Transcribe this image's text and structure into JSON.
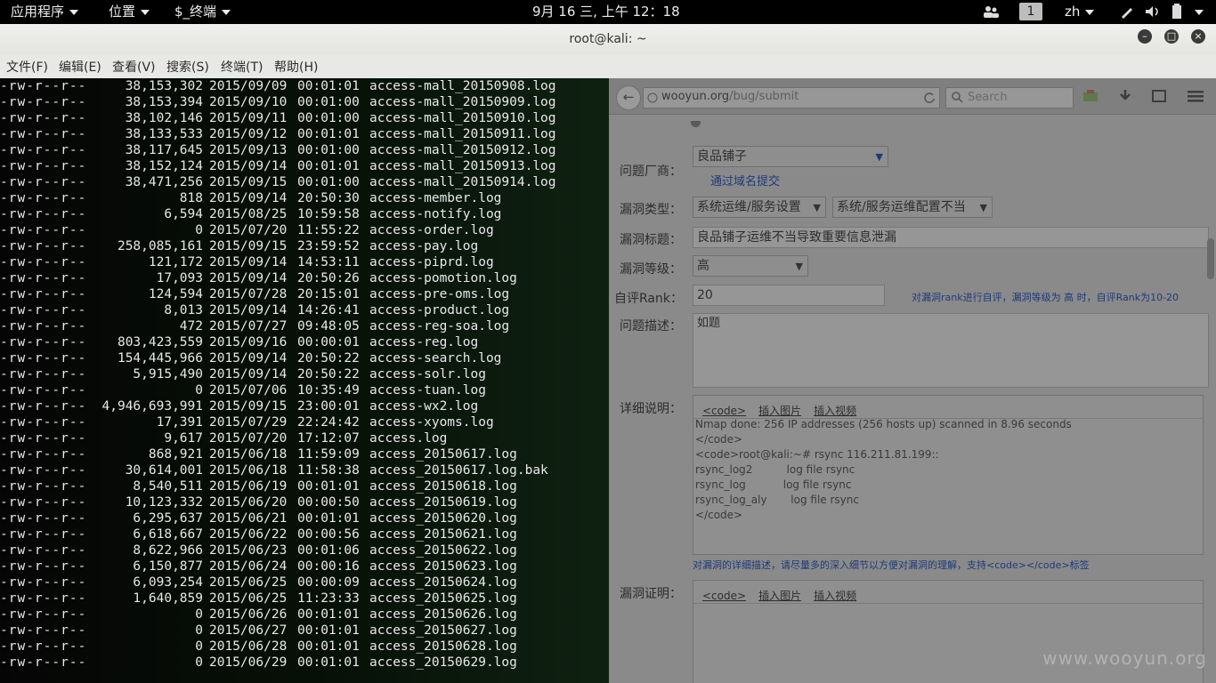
{
  "topbar": {
    "apps": "应用程序",
    "places": "位置",
    "terminal": "$_终端",
    "clock": "9月 16 三, 上午 12：18",
    "workspace": "1",
    "lang": "zh"
  },
  "window": {
    "title": "root@kali: ~",
    "menu": [
      "文件(F)",
      "编辑(E)",
      "查看(V)",
      "搜索(S)",
      "终端(T)",
      "帮助(H)"
    ]
  },
  "terminal": {
    "rows": [
      {
        "perm": "-rw-r--r--",
        "size": "38,153,302",
        "date": "2015/09/09",
        "time": "00:01:01",
        "name": "access-mall_20150908.log"
      },
      {
        "perm": "-rw-r--r--",
        "size": "38,153,394",
        "date": "2015/09/10",
        "time": "00:01:00",
        "name": "access-mall_20150909.log"
      },
      {
        "perm": "-rw-r--r--",
        "size": "38,102,146",
        "date": "2015/09/11",
        "time": "00:01:00",
        "name": "access-mall_20150910.log"
      },
      {
        "perm": "-rw-r--r--",
        "size": "38,133,533",
        "date": "2015/09/12",
        "time": "00:01:01",
        "name": "access-mall_20150911.log"
      },
      {
        "perm": "-rw-r--r--",
        "size": "38,117,645",
        "date": "2015/09/13",
        "time": "00:01:00",
        "name": "access-mall_20150912.log"
      },
      {
        "perm": "-rw-r--r--",
        "size": "38,152,124",
        "date": "2015/09/14",
        "time": "00:01:01",
        "name": "access-mall_20150913.log"
      },
      {
        "perm": "-rw-r--r--",
        "size": "38,471,256",
        "date": "2015/09/15",
        "time": "00:01:00",
        "name": "access-mall_20150914.log"
      },
      {
        "perm": "-rw-r--r--",
        "size": "818",
        "date": "2015/09/14",
        "time": "20:50:30",
        "name": "access-member.log"
      },
      {
        "perm": "-rw-r--r--",
        "size": "6,594",
        "date": "2015/08/25",
        "time": "10:59:58",
        "name": "access-notify.log"
      },
      {
        "perm": "-rw-r--r--",
        "size": "0",
        "date": "2015/07/20",
        "time": "11:55:22",
        "name": "access-order.log"
      },
      {
        "perm": "-rw-r--r--",
        "size": "258,085,161",
        "date": "2015/09/15",
        "time": "23:59:52",
        "name": "access-pay.log"
      },
      {
        "perm": "-rw-r--r--",
        "size": "121,172",
        "date": "2015/09/14",
        "time": "14:53:11",
        "name": "access-piprd.log"
      },
      {
        "perm": "-rw-r--r--",
        "size": "17,093",
        "date": "2015/09/14",
        "time": "20:50:26",
        "name": "access-pomotion.log"
      },
      {
        "perm": "-rw-r--r--",
        "size": "124,594",
        "date": "2015/07/28",
        "time": "20:15:01",
        "name": "access-pre-oms.log"
      },
      {
        "perm": "-rw-r--r--",
        "size": "8,013",
        "date": "2015/09/14",
        "time": "14:26:41",
        "name": "access-product.log"
      },
      {
        "perm": "-rw-r--r--",
        "size": "472",
        "date": "2015/07/27",
        "time": "09:48:05",
        "name": "access-reg-soa.log"
      },
      {
        "perm": "-rw-r--r--",
        "size": "803,423,559",
        "date": "2015/09/16",
        "time": "00:00:01",
        "name": "access-reg.log"
      },
      {
        "perm": "-rw-r--r--",
        "size": "154,445,966",
        "date": "2015/09/14",
        "time": "20:50:22",
        "name": "access-search.log"
      },
      {
        "perm": "-rw-r--r--",
        "size": "5,915,490",
        "date": "2015/09/14",
        "time": "20:50:22",
        "name": "access-solr.log"
      },
      {
        "perm": "-rw-r--r--",
        "size": "0",
        "date": "2015/07/06",
        "time": "10:35:49",
        "name": "access-tuan.log"
      },
      {
        "perm": "-rw-r--r--",
        "size": "4,946,693,991",
        "date": "2015/09/15",
        "time": "23:00:01",
        "name": "access-wx2.log"
      },
      {
        "perm": "-rw-r--r--",
        "size": "17,391",
        "date": "2015/07/29",
        "time": "22:24:42",
        "name": "access-xyoms.log"
      },
      {
        "perm": "-rw-r--r--",
        "size": "9,617",
        "date": "2015/07/20",
        "time": "17:12:07",
        "name": "access.log"
      },
      {
        "perm": "-rw-r--r--",
        "size": "868,921",
        "date": "2015/06/18",
        "time": "11:59:09",
        "name": "access_20150617.log"
      },
      {
        "perm": "-rw-r--r--",
        "size": "30,614,001",
        "date": "2015/06/18",
        "time": "11:58:38",
        "name": "access_20150617.log.bak"
      },
      {
        "perm": "-rw-r--r--",
        "size": "8,540,511",
        "date": "2015/06/19",
        "time": "00:01:01",
        "name": "access_20150618.log"
      },
      {
        "perm": "-rw-r--r--",
        "size": "10,123,332",
        "date": "2015/06/20",
        "time": "00:00:50",
        "name": "access_20150619.log"
      },
      {
        "perm": "-rw-r--r--",
        "size": "6,295,637",
        "date": "2015/06/21",
        "time": "00:01:01",
        "name": "access_20150620.log"
      },
      {
        "perm": "-rw-r--r--",
        "size": "6,618,667",
        "date": "2015/06/22",
        "time": "00:00:56",
        "name": "access_20150621.log"
      },
      {
        "perm": "-rw-r--r--",
        "size": "8,622,966",
        "date": "2015/06/23",
        "time": "00:01:06",
        "name": "access_20150622.log"
      },
      {
        "perm": "-rw-r--r--",
        "size": "6,150,877",
        "date": "2015/06/24",
        "time": "00:00:16",
        "name": "access_20150623.log"
      },
      {
        "perm": "-rw-r--r--",
        "size": "6,093,254",
        "date": "2015/06/25",
        "time": "00:00:09",
        "name": "access_20150624.log"
      },
      {
        "perm": "-rw-r--r--",
        "size": "1,640,859",
        "date": "2015/06/25",
        "time": "11:23:33",
        "name": "access_20150625.log"
      },
      {
        "perm": "-rw-r--r--",
        "size": "0",
        "date": "2015/06/26",
        "time": "00:01:01",
        "name": "access_20150626.log"
      },
      {
        "perm": "-rw-r--r--",
        "size": "0",
        "date": "2015/06/27",
        "time": "00:01:01",
        "name": "access_20150627.log"
      },
      {
        "perm": "-rw-r--r--",
        "size": "0",
        "date": "2015/06/28",
        "time": "00:01:01",
        "name": "access_20150628.log"
      },
      {
        "perm": "-rw-r--r--",
        "size": "0",
        "date": "2015/06/29",
        "time": "00:01:01",
        "name": "access_20150629.log"
      }
    ]
  },
  "browser": {
    "url_host": "wooyun.org",
    "url_path": "/bug/submit",
    "search_placeholder": "Search",
    "vendor_label": "问题厂商：",
    "vendor_value": "良品铺子",
    "domain_link": "通过域名提交",
    "type_label": "漏洞类型：",
    "type_value1": "系统运维/服务设置",
    "type_value2": "系统/服务运维配置不当",
    "title_label": "漏洞标题：",
    "title_value": "良品铺子运维不当导致重要信息泄漏",
    "level_label": "漏洞等级：",
    "level_value": "高",
    "rank_label": "自评Rank：",
    "rank_value": "20",
    "rank_hint": "对漏洞rank进行自评，漏洞等级为 高 时，自评Rank为10-20",
    "desc_label": "问题描述：",
    "desc_value": "如题",
    "detail_label": "详细说明：",
    "editor_tabs": [
      "<code>",
      "插入图片",
      "插入视频"
    ],
    "code_lines": [
      "Nmap done: 256 IP addresses (256 hosts up) scanned in 8.96 seconds",
      "</code>",
      "<code>root@kali:~# rsync 116.211.81.199::",
      "rsync_log2          log file rsync",
      "rsync_log           log file rsync",
      "rsync_log_aly       log file rsync",
      "</code>"
    ],
    "detail_hint": "对漏洞的详细描述，请尽量多的深入细节以方便对漏洞的理解，支持<code></code>标签",
    "proof_label": "漏洞证明：",
    "watermark": "www.wooyun.org"
  }
}
